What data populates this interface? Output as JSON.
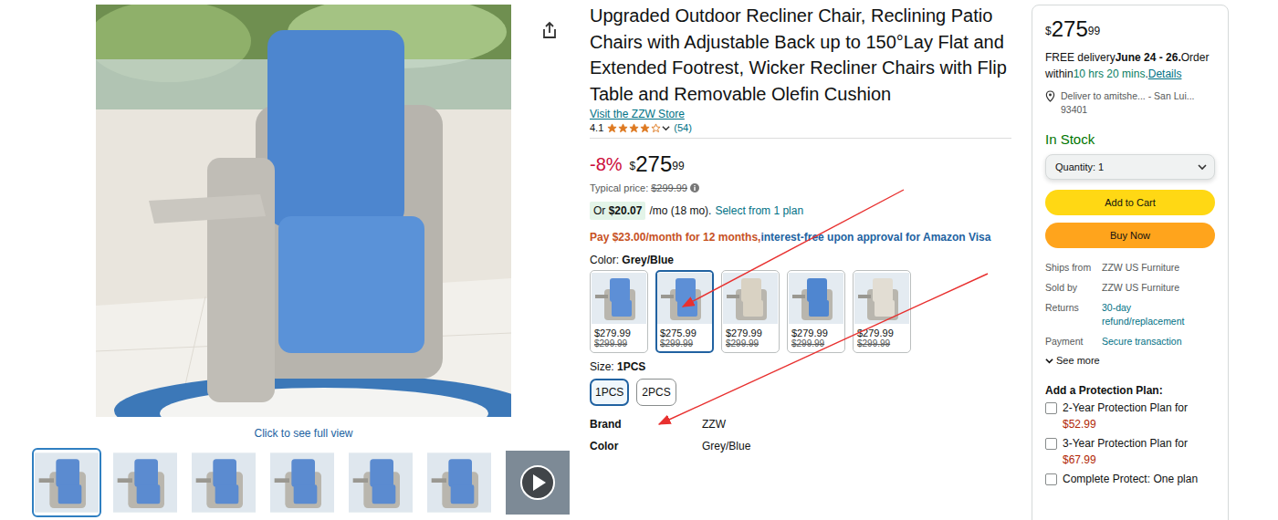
{
  "gallery": {
    "caption": "Click to see full view",
    "thumbnails": [
      {
        "kind": "image",
        "selected": true
      },
      {
        "kind": "image",
        "selected": false
      },
      {
        "kind": "image",
        "selected": false
      },
      {
        "kind": "image",
        "selected": false
      },
      {
        "kind": "image",
        "selected": false
      },
      {
        "kind": "image",
        "selected": false
      },
      {
        "kind": "video",
        "selected": false
      }
    ]
  },
  "product": {
    "title": "Upgraded Outdoor Recliner Chair, Reclining Patio Chairs with Adjustable Back up to 150°Lay Flat and Extended Footrest, Wicker Recliner Chairs with Flip Table and Removable Olefin Cushion",
    "store_link": "Visit the ZZW Store",
    "rating": "4.1",
    "stars": 4,
    "review_count": "(54)"
  },
  "price": {
    "discount": "-8%",
    "currency": "$",
    "whole": "275",
    "fraction": "99",
    "typical_label": "Typical price:",
    "typical_price": "$299.99",
    "monthly_prefix": "Or",
    "monthly_amount": "$20.07",
    "monthly_suffix": "/mo (18 mo).",
    "plan_link": "Select from 1 plan",
    "card_offer_highlight": "Pay $23.00/month for 12 months,",
    "card_offer_rest": "interest-free upon approval for Amazon Visa"
  },
  "color_option": {
    "label": "Color:",
    "value": "Grey/Blue",
    "swatches": [
      {
        "price": "$279.99",
        "old_price": "$299.99",
        "selected": false,
        "color": "#5d8fd6"
      },
      {
        "price": "$275.99",
        "old_price": "$299.99",
        "selected": true,
        "color": "#5d8fd6"
      },
      {
        "price": "$279.99",
        "old_price": "$299.99",
        "selected": false,
        "color": "#d9d2c3"
      },
      {
        "price": "$279.99",
        "old_price": "$299.99",
        "selected": false,
        "color": "#4f86d0"
      },
      {
        "price": "$279.99",
        "old_price": "$299.99",
        "selected": false,
        "color": "#e2ddd3"
      }
    ]
  },
  "size_option": {
    "label": "Size:",
    "value": "1PCS",
    "options": [
      {
        "label": "1PCS",
        "selected": true
      },
      {
        "label": "2PCS",
        "selected": false
      }
    ]
  },
  "details": [
    {
      "label": "Brand",
      "value": "ZZW"
    },
    {
      "label": "Color",
      "value": "Grey/Blue"
    }
  ],
  "buy_box": {
    "currency": "$",
    "whole": "275",
    "fraction": "99",
    "delivery_prefix": "FREE delivery",
    "delivery_date": "June 24 - 26.",
    "order_prefix": "Order within",
    "order_time": "10 hrs 20 mins",
    "order_suffix": ".",
    "details_link": "Details",
    "location": "Deliver to amitshe... - San Lui... 93401",
    "stock": "In Stock",
    "quantity": "Quantity: 1",
    "add_to_cart": "Add to Cart",
    "buy_now": "Buy Now",
    "info": [
      {
        "label": "Ships from",
        "value": "ZZW US Furniture",
        "link": false
      },
      {
        "label": "Sold by",
        "value": "ZZW US Furniture",
        "link": false
      },
      {
        "label": "Returns",
        "value": "30-day refund/replacement",
        "link": true
      },
      {
        "label": "Payment",
        "value": "Secure transaction",
        "link": true
      }
    ],
    "see_more": "See more",
    "protection_title": "Add a Protection Plan:",
    "plans": [
      {
        "label": "2-Year Protection Plan for",
        "price": "$52.99",
        "checked": false
      },
      {
        "label": "3-Year Protection Plan for",
        "price": "$67.99",
        "checked": false
      },
      {
        "label": "Complete Protect: One plan",
        "price": "",
        "checked": false
      }
    ]
  }
}
